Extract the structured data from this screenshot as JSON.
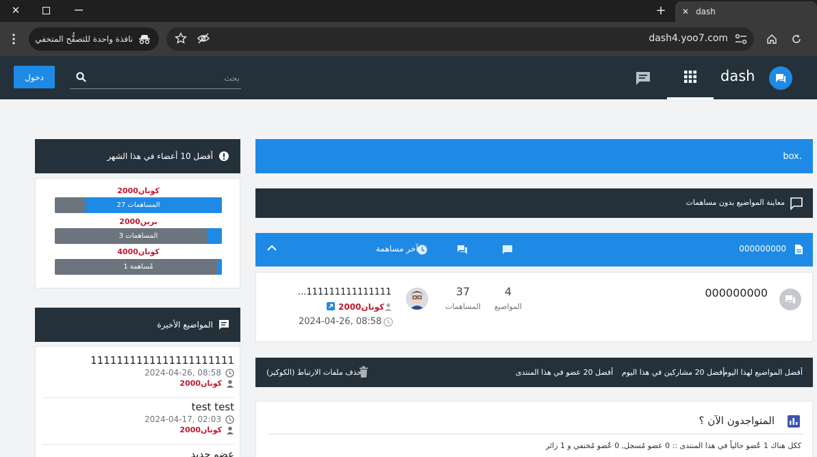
{
  "browser": {
    "tab_title": "dash",
    "new_tab_label": "+",
    "incognito_label": "نافذة واحدة للتصفُّح المتخفي",
    "url": "dash4.yoo7.com"
  },
  "header": {
    "site_name": "dash",
    "login_label": "دخول",
    "search_placeholder": "بحث"
  },
  "top_members": {
    "title": "أفضل 10 أعضاء في هذا الشهر",
    "members": [
      {
        "name": "كونان2000",
        "posts_label": "27 المساهمات",
        "fill": 0.82
      },
      {
        "name": "برين2000",
        "posts_label": "3 المساهمات",
        "fill": 0.09
      },
      {
        "name": "كونان4000",
        "posts_label": "1 مُساهمة",
        "fill": 0.03
      }
    ]
  },
  "recent_topics": {
    "title": "المواضيع الأخيرة",
    "items": [
      {
        "title": "1111111111111111111111",
        "date": "2024-04-26, 08:58",
        "author": "كونان2000"
      },
      {
        "title": "test test",
        "date": "2024-04-17, 02:03",
        "author": "كونان2000"
      },
      {
        "title": "عضو جديد"
      }
    ]
  },
  "main": {
    "box_text": "box.",
    "unanswered_label": "معاينة المواضيع بدون مساهمات",
    "category": {
      "title": "000000000",
      "last_post_label": "آخر مساهمة"
    },
    "forum": {
      "name": "000000000",
      "topics_count": "4",
      "topics_label": "المواضيع",
      "posts_count": "37",
      "posts_label": "المساهمات",
      "last_topic": "...111111111111111",
      "last_author": "كونان2000",
      "last_date": "2024-04-26, 08:58"
    },
    "links": {
      "top_topics_today": "أفضل المواضيع لهذا اليوم",
      "top_posters_today": "أفضل 20 مشاركين في هذا اليوم",
      "top_members": "أفضل 20 عضو في هذا المنتدى",
      "delete_cookies": "حذف ملفات الارتباط (الكوكيز)"
    },
    "online": {
      "title": "المتواجدون الآن ؟",
      "summary": "ككل هناك 1 عُضو حالياً في هذا المنتدى :: 0 عضو مُسجل, 0 عُضو مُختفي و 1 زائر"
    }
  },
  "colors": {
    "accent": "#1f8ae5",
    "dark": "#24313b",
    "author_red": "#c2182f"
  }
}
